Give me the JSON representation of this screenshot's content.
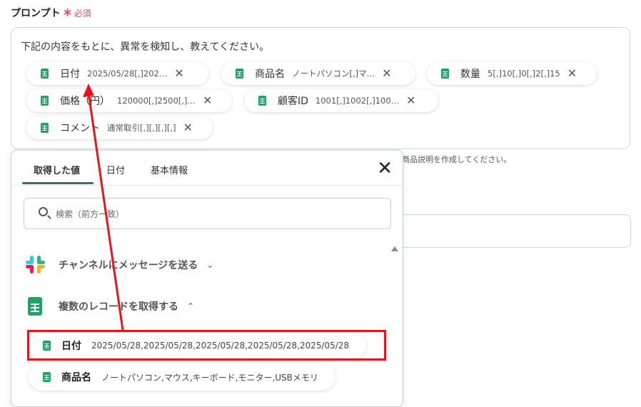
{
  "field": {
    "label": "プロンプト",
    "required_mark": "＊",
    "required_text": "必須"
  },
  "prompt": {
    "text": "下記の内容をもとに、異常を検知し、教えてください。",
    "chips": [
      {
        "label": "日付",
        "value": "2025/05/28[,]202…",
        "icon": "sheets-icon"
      },
      {
        "label": "商品名",
        "value": "ノートパソコン[,]マ…",
        "icon": "sheets-icon"
      },
      {
        "label": "数量",
        "value": "5[,]10[,]0[,]2[,]15",
        "icon": "sheets-icon"
      },
      {
        "label": "価格（円）",
        "value": "120000[,]2500[,]…",
        "icon": "sheets-icon"
      },
      {
        "label": "顧客ID",
        "value": "1001[,]1002[,]100…",
        "icon": "sheets-icon"
      },
      {
        "label": "コメント",
        "value": "通常取引[,][,][,][,]",
        "icon": "sheets-icon"
      }
    ],
    "remove_icon": "close-icon"
  },
  "hint": "商品説明を作成してください。",
  "popup": {
    "tabs": [
      {
        "label": "取得した値",
        "active": true
      },
      {
        "label": "日付",
        "active": false
      },
      {
        "label": "基本情報",
        "active": false
      }
    ],
    "close_symbol": "✕",
    "search": {
      "placeholder": "検索（前方一致）"
    },
    "sections": [
      {
        "title": "チャンネルにメッセージを送る",
        "chevron": "⌄",
        "icon": "slack-icon"
      },
      {
        "title": "複数のレコードを取得する",
        "chevron": "⌃",
        "icon": "sheets-icon"
      }
    ],
    "rows": [
      {
        "label": "日付",
        "value": "2025/05/28,2025/05/28,2025/05/28,2025/05/28,2025/05/28"
      },
      {
        "label": "商品名",
        "value": "ノートパソコン,マウス,キーボード,モニター,USBメモリ"
      }
    ]
  },
  "colors": {
    "required": "#e0405a",
    "sheets_green": "#1fa463",
    "tab_underline": "#2f6f80",
    "annotation": "#e8141a"
  }
}
